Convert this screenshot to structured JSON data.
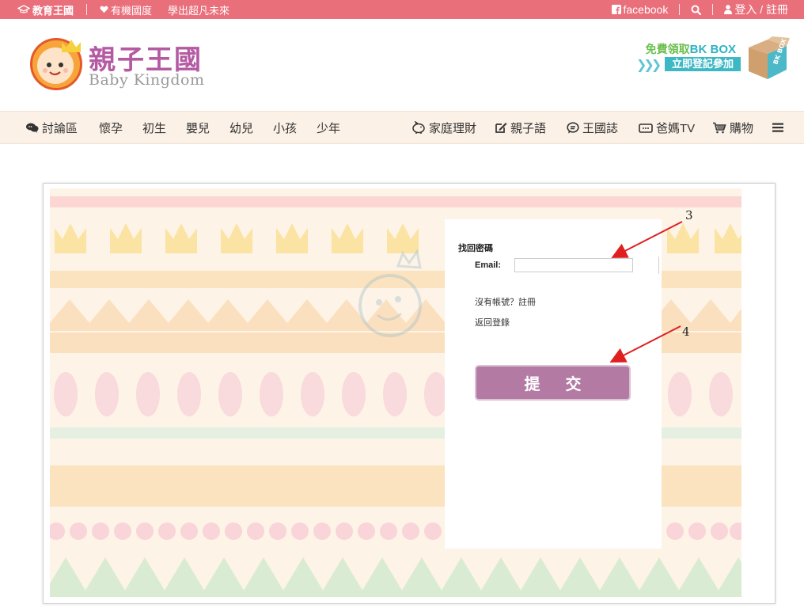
{
  "topbar": {
    "brand": "教育王國",
    "organic": "有機國度",
    "slogan": "學出超凡未來",
    "facebook": "facebook",
    "login": "登入 / 註冊"
  },
  "header": {
    "logo_title": "親子王國",
    "logo_subtitle": "Baby Kingdom",
    "promo_line1_prefix": "免費領取",
    "promo_line1_brand": "BK BOX",
    "promo_line2": "立即登記參加",
    "box_label": "BK BOX"
  },
  "nav": {
    "left": [
      {
        "label": "討論區",
        "icon": "chat-icon"
      },
      {
        "label": "懷孕"
      },
      {
        "label": "初生"
      },
      {
        "label": "嬰兒"
      },
      {
        "label": "幼兒"
      },
      {
        "label": "小孩"
      },
      {
        "label": "少年"
      }
    ],
    "right": [
      {
        "label": "家庭理財",
        "icon": "piggy-bank-icon"
      },
      {
        "label": "親子語",
        "icon": "edit-icon"
      },
      {
        "label": "王國誌",
        "icon": "speech-icon"
      },
      {
        "label": "爸媽TV",
        "icon": "tv-icon"
      },
      {
        "label": "購物",
        "icon": "cart-icon"
      }
    ]
  },
  "form": {
    "title": "找回密碼",
    "email_label": "Email:",
    "email_value": "",
    "no_account": "沒有帳號？註冊",
    "back_login": "返回登錄",
    "submit": "提交"
  },
  "annotations": {
    "mark3": "3",
    "mark4": "4"
  },
  "colors": {
    "topbar": "#e96f7b",
    "brand_purple": "#b45aa3",
    "nav_bg": "#fbf1e6",
    "submit": "#b37aa4"
  }
}
